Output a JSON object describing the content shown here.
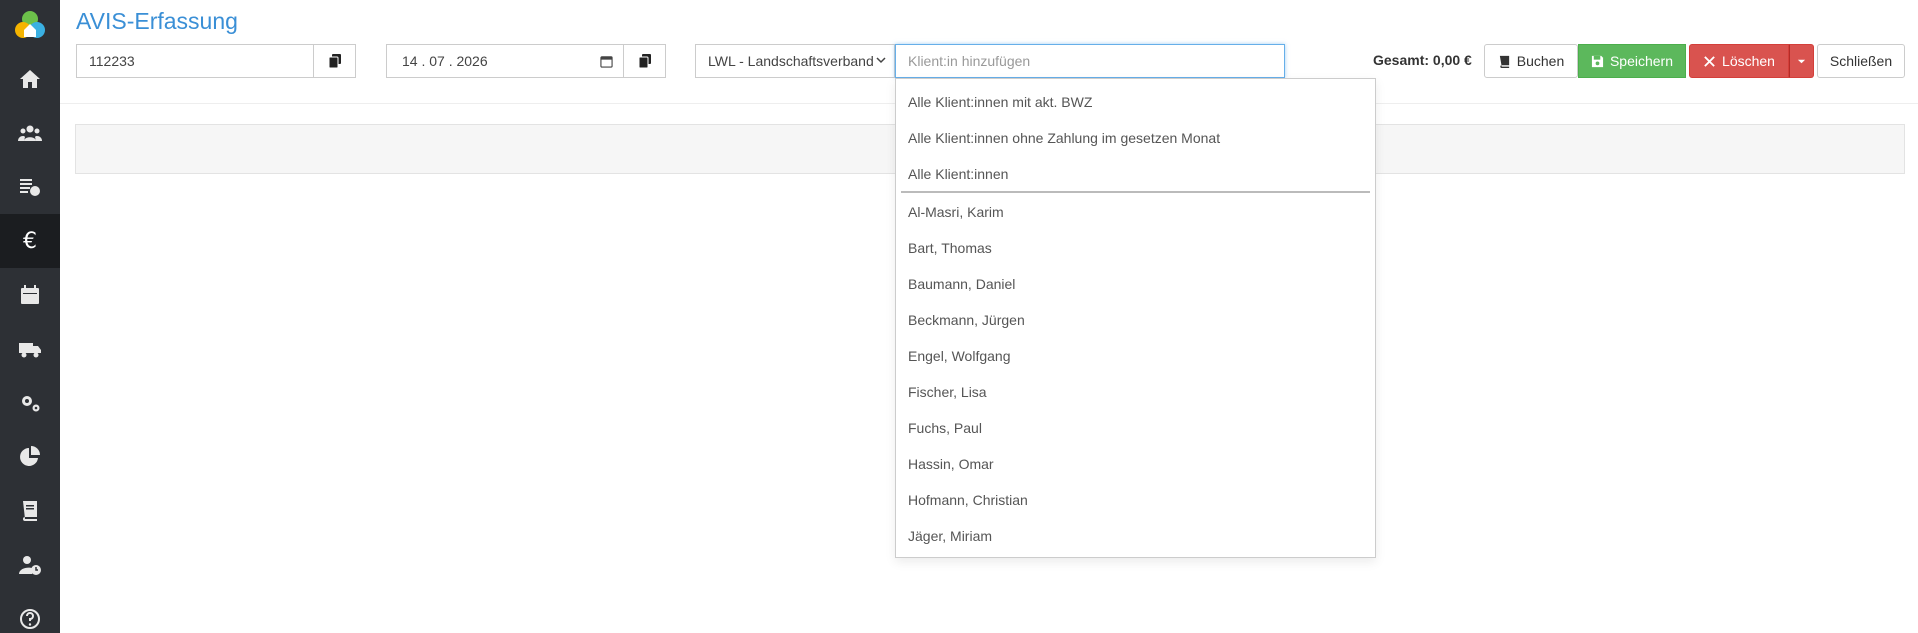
{
  "header": {
    "title": "AVIS-Erfassung",
    "number_value": "112233",
    "date_value": "14 . 07 . 2026",
    "payer_select": "LWL - Landschaftsverband",
    "client_search": {
      "placeholder": "Klient:in hinzufügen",
      "value": ""
    },
    "total_text": "Gesamt: 0,00 €"
  },
  "toolbar": {
    "book_label": "Buchen",
    "save_label": "Speichern",
    "delete_label": "Löschen",
    "close_label": "Schließen"
  },
  "sidebar": {
    "items": [
      {
        "icon": "home-icon"
      },
      {
        "icon": "users-icon"
      },
      {
        "icon": "invoice-icon"
      },
      {
        "icon": "euro-icon",
        "label": "€",
        "active": true
      },
      {
        "icon": "calendar-icon"
      },
      {
        "icon": "truck-icon"
      },
      {
        "icon": "cogs-icon"
      },
      {
        "icon": "pie-chart-icon"
      },
      {
        "icon": "book-icon"
      },
      {
        "icon": "user-clock-icon"
      },
      {
        "icon": "help-icon"
      }
    ]
  },
  "dropdown": {
    "group_options": [
      "Alle Klient:innen mit akt. BWZ",
      "Alle Klient:innen ohne Zahlung im gesetzen Monat",
      "Alle Klient:innen"
    ],
    "clients": [
      "Al-Masri, Karim",
      "Bart, Thomas",
      "Baumann, Daniel",
      "Beckmann, Jürgen",
      "Engel, Wolfgang",
      "Fischer, Lisa",
      "Fuchs, Paul",
      "Hassin, Omar",
      "Hofmann, Christian",
      "Jäger, Miriam"
    ]
  },
  "colors": {
    "sidebar_bg": "#2d3035",
    "title": "#3a8fd6",
    "save": "#5cb85c",
    "delete": "#d9534f"
  }
}
